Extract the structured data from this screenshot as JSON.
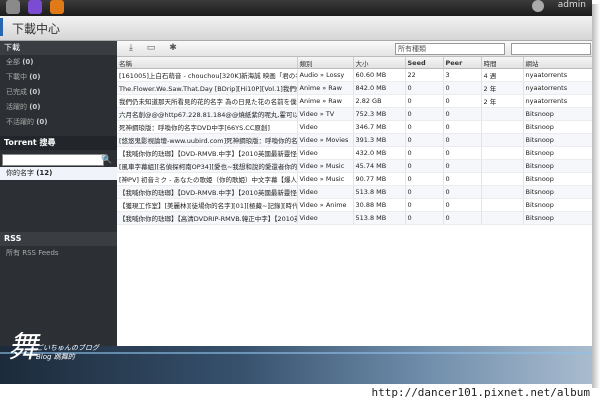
{
  "taskbar": {
    "user": "admin"
  },
  "window": {
    "title": "下載中心"
  },
  "sidebar": {
    "download_header": "下載",
    "items": [
      {
        "label": "全部",
        "count": "(0)"
      },
      {
        "label": "下載中",
        "count": "(0)"
      },
      {
        "label": "已完成",
        "count": "(0)"
      },
      {
        "label": "活躍的",
        "count": "(0)"
      },
      {
        "label": "不活躍的",
        "count": "(0)"
      }
    ],
    "torrent_search_header": "Torrent 搜尋",
    "search_button": "🔍",
    "your_name": {
      "label": "你的名字",
      "count": "(12)"
    },
    "rss_header": "RSS",
    "rss_item": "所有 RSS Feeds"
  },
  "toolbar": {
    "filter_placeholder": "所有種類"
  },
  "table": {
    "columns": [
      "名稱",
      "類別",
      "大小",
      "Seed",
      "Peer",
      "時間",
      "網站"
    ],
    "rows": [
      [
        "[161005]上白石萌音 - chouchou[320K]新海誠 映画「君の名...",
        "Audio » Lossy",
        "60.60 MB",
        "22",
        "3",
        "4 週",
        "nyaatorrents"
      ],
      [
        "The.Flower.We.Saw.That.Day [BDrip][Hi10P][Vol.1]我們仍...",
        "Anime » Raw",
        "842.0 MB",
        "0",
        "0",
        "2 年",
        "nyaatorrents"
      ],
      [
        "我們仍未知道那天所看見的花的名字 為の日見た花の名前を僕達は...",
        "Anime » Raw",
        "2.82 GB",
        "0",
        "0",
        "2 年",
        "nyaatorrents"
      ],
      [
        "六月名創@@@http67.228.81.184@@燒紙紫的呢丸,霍可以選你的字...",
        "Video » TV",
        "752.3 MB",
        "0",
        "0",
        "",
        "Bitsnoop"
      ],
      [
        "死神鋼琅版：呼喚你的名字DVD中字[66YS.CC原創]",
        "Video",
        "346.7 MB",
        "0",
        "0",
        "",
        "Bitsnoop"
      ],
      [
        "[悠悠鬼影視論壇-www.uubird.com]死神鋼琅版：呼喚你的名字...",
        "Video » Movies",
        "391.3 MB",
        "0",
        "0",
        "",
        "Bitsnoop"
      ],
      [
        "【我喊你你的琺瑯】【DVD-RMVB.中字】【2010英國最新靈怪...",
        "Video",
        "432.0 MB",
        "0",
        "0",
        "",
        "Bitsnoop"
      ],
      [
        "[風車字幕組][名偵探柯南OP34][愛也~我想和說的愛還者你的...",
        "Video » Music",
        "45.74 MB",
        "0",
        "0",
        "",
        "Bitsnoop"
      ],
      [
        "[神PV] 初音ミク - あなたの歌姫（你的歌姫）中文字幕【爆人...",
        "Video » Music",
        "90.77 MB",
        "0",
        "0",
        "",
        "Bitsnoop"
      ],
      [
        "【我喊你你的琺瑯】【DVD-RMVB.中字】【2010英國最新靈怪...",
        "Video",
        "513.8 MB",
        "0",
        "0",
        "",
        "Bitsnoop"
      ],
      [
        "【獲現工作室】[美麗林][徒場你的名字][01][極藏~記錄][時代]...",
        "Video » Anime",
        "30.88 MB",
        "0",
        "0",
        "",
        "Bitsnoop"
      ],
      [
        "【我喊你你的琺瑯】【高清DVDRIP-RMVB.韓正中字】【2010英...",
        "Video",
        "513.8 MB",
        "0",
        "0",
        "",
        "Bitsnoop"
      ]
    ]
  },
  "watermark": {
    "mark": "舞",
    "text": "ごいちゅんのブログ Blog 跳舞的",
    "url": "http://dancer101.pixnet.net/album"
  }
}
